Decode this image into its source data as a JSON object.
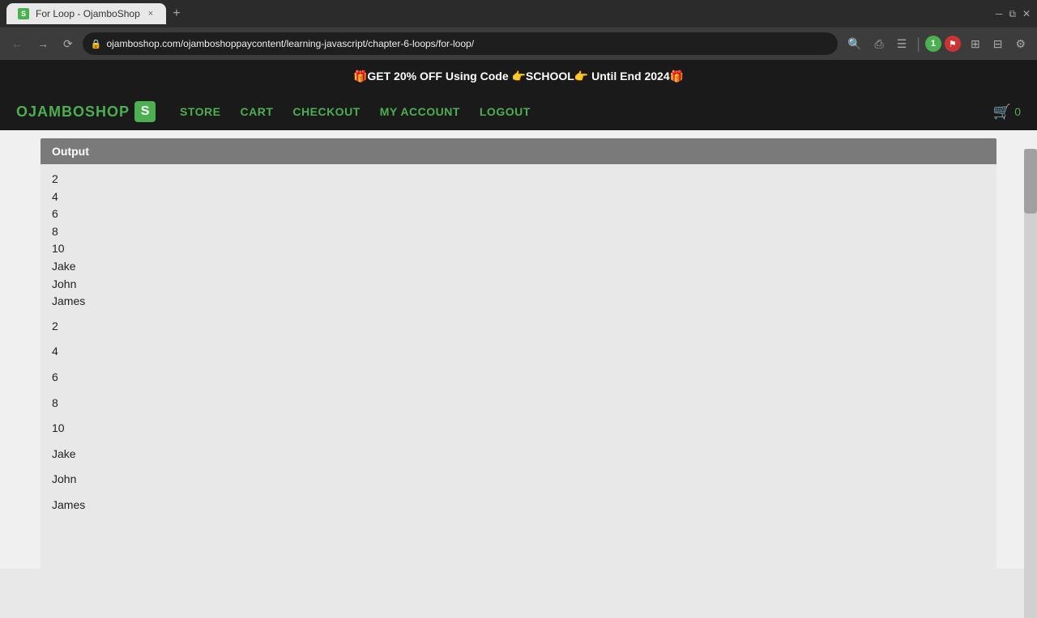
{
  "browser": {
    "tab_title": "For Loop - OjamboShop",
    "tab_favicon": "S",
    "url": "ojamboshop.com/ojamboshoppaycontent/learning-javascript/chapter-6-loops/for-loop/",
    "new_tab_label": "+",
    "tab_close": "×"
  },
  "promo": {
    "text": "🎁GET 20% OFF Using Code 👉SCHOOL👉 Until End 2024🎁"
  },
  "nav": {
    "logo_text": "OJAMBOSHOP",
    "logo_s": "S",
    "store": "STORE",
    "cart": "CART",
    "checkout": "CHECKOUT",
    "my_account": "MY ACCOUNT",
    "logout": "LOGOUT",
    "cart_count": "0"
  },
  "output": {
    "header": "Output",
    "lines_compact": [
      "2",
      "4",
      "6",
      "8",
      "10",
      "Jake",
      "John",
      "James"
    ],
    "lines_spaced": [
      "2",
      "4",
      "6",
      "8",
      "10",
      "Jake",
      "John",
      "James"
    ]
  },
  "colors": {
    "green": "#4caf50",
    "dark_bg": "#1a1a1a",
    "output_header": "#7a7a7a",
    "output_bg": "#e8e8e8",
    "page_bg": "#f0f0f0"
  }
}
